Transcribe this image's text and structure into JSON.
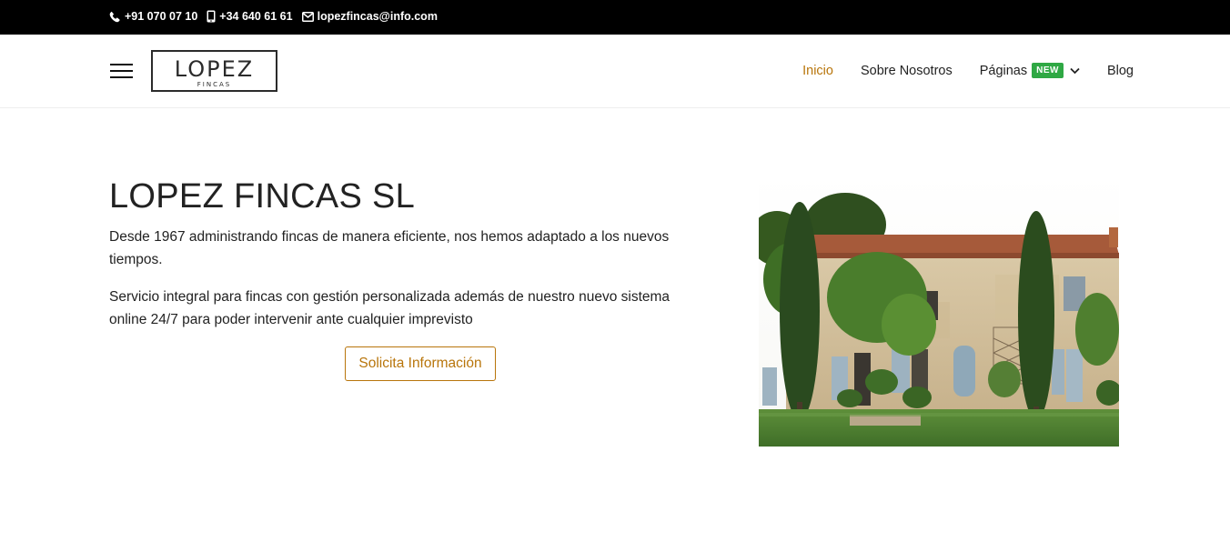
{
  "topbar": {
    "phone": "+91 070 07 10",
    "mobile": "+34 640 61 61",
    "email": "lopezfincas@info.com"
  },
  "logo": {
    "title": "LOPEZ",
    "subtitle": "FINCAS"
  },
  "nav": {
    "items": [
      {
        "label": "Inicio",
        "active": true
      },
      {
        "label": "Sobre Nosotros"
      },
      {
        "label": "Páginas",
        "badge": "NEW"
      },
      {
        "label": "Blog"
      }
    ]
  },
  "hero": {
    "title": "LOPEZ FINCAS SL",
    "paragraph1": "Desde 1967 administrando fincas de manera eficiente, nos hemos adaptado a los nuevos tiempos.",
    "paragraph2": "Servicio integral para fincas con gestión personalizada además de nuestro nuevo sistema online 24/7 para poder intervenir ante cualquier imprevisto",
    "cta_label": "Solicita Información"
  },
  "colors": {
    "accent": "#b8750b",
    "badge": "#2fa844",
    "topbar": "#000000"
  },
  "icons": [
    "phone-icon",
    "mobile-icon",
    "envelope-icon",
    "hamburger-icon",
    "chevron-down-icon"
  ]
}
